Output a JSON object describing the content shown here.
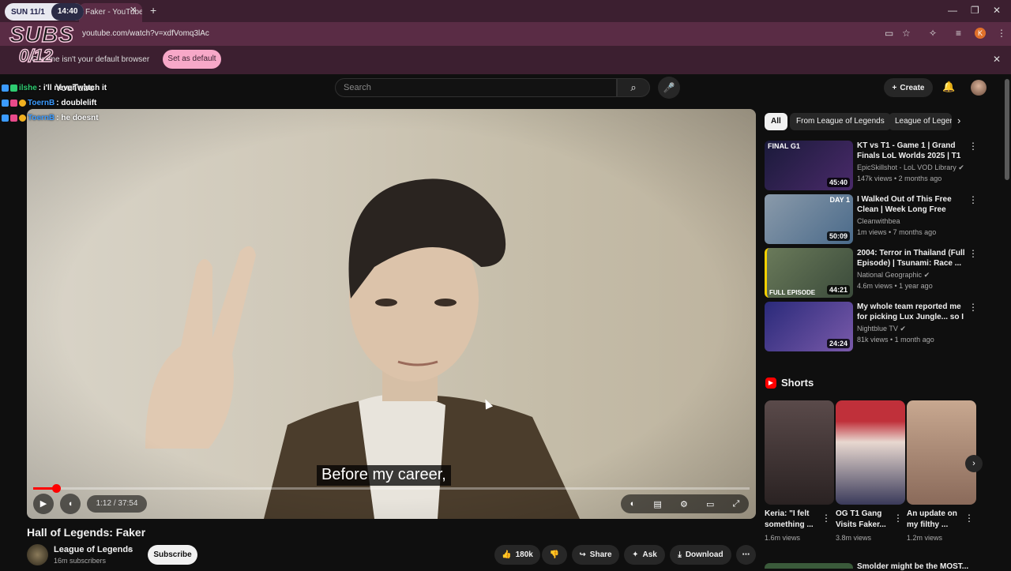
{
  "overlay": {
    "clock_day": "SUN 11/1",
    "clock_time": "14:40",
    "subs_label": "SUBS",
    "subs_count": "0/12",
    "chat": [
      {
        "user": "ilshe",
        "msg": ": i'll never watch it"
      },
      {
        "user": "ToernB",
        "msg": ": doublelift"
      },
      {
        "user": "ToernB",
        "msg": ": he doesnt"
      }
    ]
  },
  "browser": {
    "tab_title": "Faker - YouTube",
    "url": "youtube.com/watch?v=xdfVomq3lAc",
    "profile_initial": "K",
    "infobar_text": "Chrome isn't your default browser",
    "set_default_label": "Set as default"
  },
  "youtube": {
    "logo": "YouTube",
    "search_placeholder": "Search",
    "create_label": "Create"
  },
  "player": {
    "caption": "Before my career,",
    "time": "1:12 / 37:54",
    "progress": 0.032
  },
  "video": {
    "title": "Hall of Legends: Faker",
    "channel": "League of Legends",
    "subscribers": "16m subscribers",
    "subscribe_label": "Subscribe",
    "likes": "180k",
    "share_label": "Share",
    "ask_label": "Ask",
    "download_label": "Download"
  },
  "chips": [
    "All",
    "From League of Legends",
    "League of Legends"
  ],
  "recommendations": [
    {
      "title": "KT vs T1 - Game 1 | Grand Finals LoL Worlds 2025 | T1 vs...",
      "channel": "EpicSkillshot - LoL VOD Library",
      "meta": "147k views • 2 months ago",
      "duration": "45:40",
      "thumb_text": "FINAL G1",
      "color": "#2a1f4a"
    },
    {
      "title": "I Walked Out of This Free Clean | Week Long Free Deep Clean",
      "channel": "Cleanwithbea",
      "meta": "1m views • 7 months ago",
      "duration": "50:09",
      "thumb_text": "DAY 1",
      "color": "#6a7a8a"
    },
    {
      "title": "2004: Terror in Thailand (Full Episode) | Tsunami: Race ...",
      "channel": "National Geographic",
      "meta": "4.6m views • 1 year ago",
      "duration": "44:21",
      "thumb_text": "FULL EPISODE",
      "color": "#5a6a4a"
    },
    {
      "title": "My whole team reported me for picking Lux Jungle... so I had t...",
      "channel": "Nightblue TV",
      "meta": "81k views • 1 month ago",
      "duration": "24:24",
      "thumb_text": "",
      "color": "#3a3a8a"
    }
  ],
  "shorts": {
    "label": "Shorts",
    "items": [
      {
        "title": "Keria: \"I felt something ...",
        "views": "1.6m views",
        "color": "#4a3a3a"
      },
      {
        "title": "OG T1 Gang Visits Faker...",
        "views": "3.8m views",
        "color": "#c0303a"
      },
      {
        "title": "An update on my filthy ...",
        "views": "1.2m views",
        "color": "#b08a70"
      }
    ]
  },
  "next_rec_title": "Smolder might be the MOST..."
}
